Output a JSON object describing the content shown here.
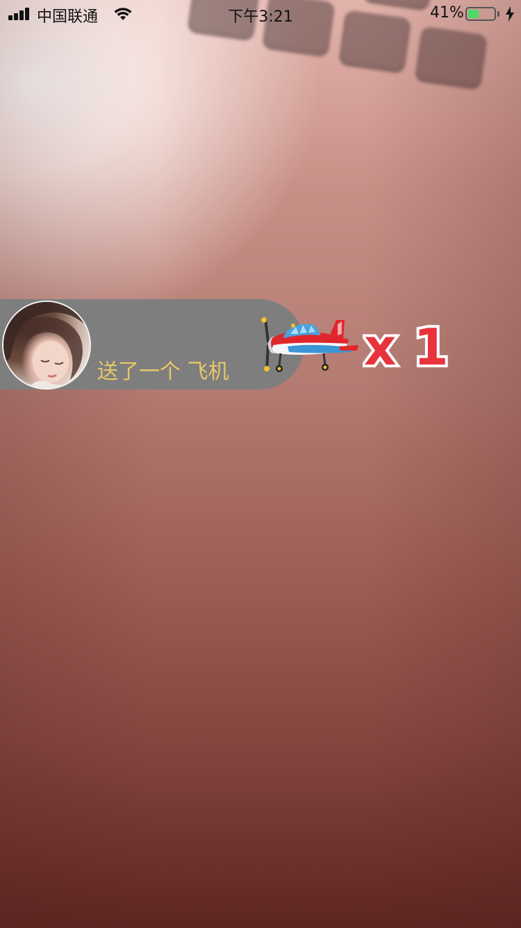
{
  "status_bar": {
    "carrier": "中国联通",
    "time": "下午3:21",
    "battery_percent": "41%",
    "battery_level": 0.41,
    "signal_bars": 4
  },
  "gift_message": {
    "text": "送了一个 飞机",
    "gift_name": "飞机",
    "gift_icon": "airplane-icon",
    "count_text": "x 1"
  },
  "colors": {
    "gift_text": "#e8c76a",
    "gift_bar": "#7e7e7e",
    "count_fill": "#e8333c",
    "count_stroke": "#ffffff",
    "battery_fill": "#4cd964"
  }
}
